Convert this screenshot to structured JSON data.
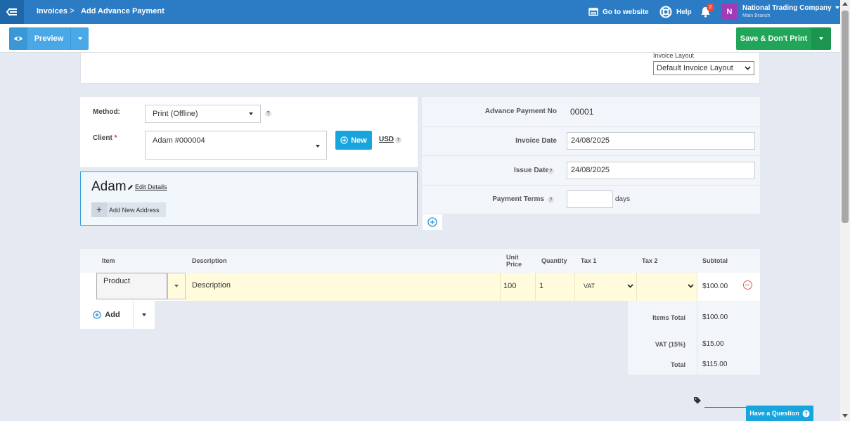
{
  "topbar": {
    "breadcrumb_parent": "Invoices",
    "breadcrumb_separator": ">",
    "breadcrumb_current": "Add Advance Payment",
    "go_to_website": "Go to website",
    "help": "Help",
    "notification_count": "2",
    "avatar_letter": "N",
    "company_name": "National Trading Company",
    "branch_name": "Main Branch"
  },
  "toolbar": {
    "preview_label": "Preview",
    "save_label": "Save & Don't Print"
  },
  "layout": {
    "label": "Invoice Layout",
    "selected": "Default Invoice Layout"
  },
  "form": {
    "method_label": "Method:",
    "method_value": "Print (Offline)",
    "client_label": "Client",
    "client_required": "*",
    "client_value": "Adam #000004",
    "new_button": "New",
    "currency": "USD",
    "help_mark": "?"
  },
  "client_card": {
    "name": "Adam",
    "edit_link": "Edit Details",
    "add_address": "Add New Address"
  },
  "details": {
    "advance_no_label": "Advance Payment No",
    "advance_no_value": "00001",
    "invoice_date_label": "Invoice Date",
    "invoice_date_value": "24/08/2025",
    "issue_date_label": "Issue Date",
    "issue_date_value": "24/08/2025",
    "payment_terms_label": "Payment Terms",
    "payment_terms_value": "",
    "days_label": "days"
  },
  "items": {
    "headers": {
      "item": "Item",
      "description": "Description",
      "unit_price_1": "Unit",
      "unit_price_2": "Price",
      "quantity": "Quantity",
      "tax1": "Tax 1",
      "tax2": "Tax 2",
      "subtotal": "Subtotal"
    },
    "rows": [
      {
        "item": "Product",
        "description": "Description",
        "unit_price": "100",
        "quantity": "1",
        "tax1": "VAT",
        "tax2": "",
        "subtotal": "$100.00"
      }
    ],
    "add_label": "Add"
  },
  "totals": {
    "items_total_label": "Items Total",
    "items_total_value": "$100.00",
    "vat_label": "VAT (15%)",
    "vat_value": "$15.00",
    "total_label": "Total",
    "total_value": "$115.00"
  },
  "help_widget": {
    "label": "Have a Question"
  },
  "colors": {
    "topbar": "#2b7cc4",
    "preview_button": "#4aa8e6",
    "save_button": "#20a559",
    "new_button": "#18a5dd",
    "row_highlight": "#fffbdc",
    "remove": "#e25555"
  }
}
